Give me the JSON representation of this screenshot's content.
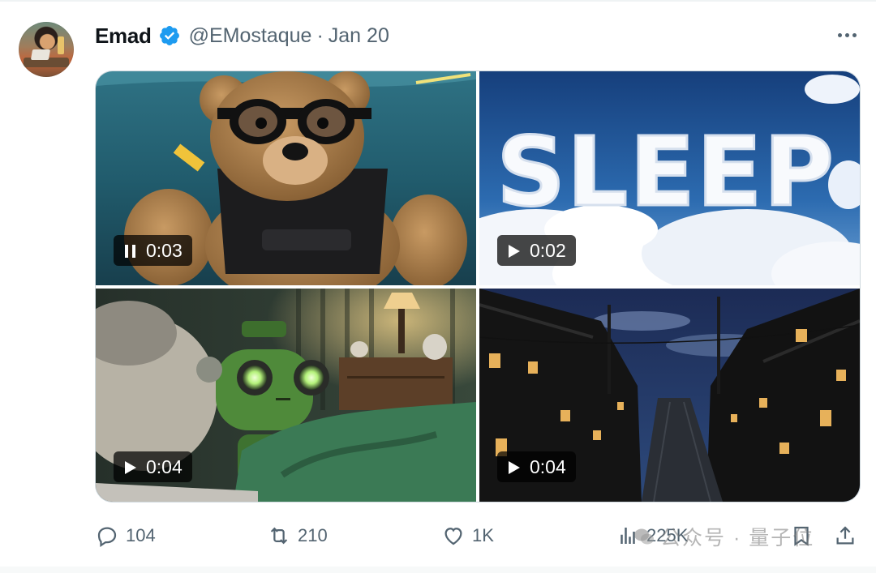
{
  "tweet": {
    "display_name": "Emad",
    "handle": "@EMostaque",
    "separator": "·",
    "date": "Jan 20",
    "verified_color": "#1d9bf0"
  },
  "media": [
    {
      "scene": "teddy bear with goggles swimming underwater",
      "duration": "0:03",
      "state": "pause-icon"
    },
    {
      "scene": "clouds spelling SLEEP in blue sky",
      "cloud_text": "SLEEP",
      "duration": "0:02",
      "state": "play-icon"
    },
    {
      "scene": "green robot in bed with lamp",
      "duration": "0:04",
      "state": "play-icon"
    },
    {
      "scene": "night street of old wooden houses",
      "duration": "0:04",
      "state": "play-icon"
    }
  ],
  "actions": {
    "replies": "104",
    "reposts": "210",
    "likes": "1K",
    "views": "225K"
  },
  "watermark": {
    "text": "公众号 · 量子位"
  },
  "colors": {
    "muted_text": "#536471",
    "border": "#cfd9de",
    "verified": "#1d9bf0"
  }
}
